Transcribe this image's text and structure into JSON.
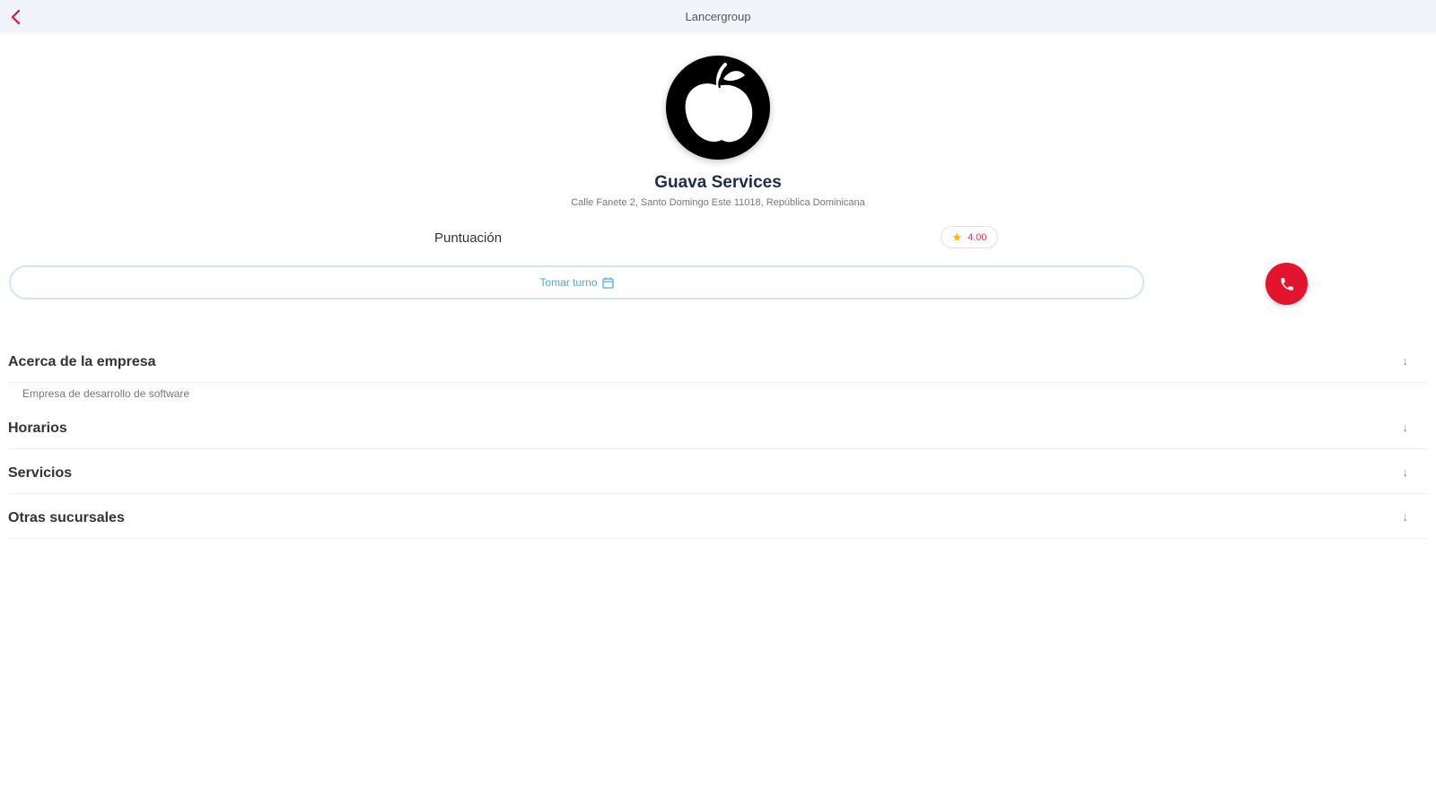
{
  "header": {
    "title": "Lancergroup",
    "back_icon": "chevron-left-icon",
    "accent_color": "#e3142e"
  },
  "company": {
    "name": "Guava Services",
    "address": "Calle Fanete 2, Santo Domingo Este 11018, República Dominicana",
    "logo_icon": "apple-logo-icon"
  },
  "rating": {
    "label": "Puntuación",
    "value": "4.00",
    "icon": "star-icon",
    "star_color": "#f5b400"
  },
  "actions": {
    "take_turn_label": "Tomar turno",
    "take_turn_icon": "calendar-icon",
    "call_icon": "phone-icon",
    "call_color": "#e3142e"
  },
  "sections": [
    {
      "title": "Acerca de la empresa",
      "description": "Empresa de desarrollo de software"
    },
    {
      "title": "Horarios"
    },
    {
      "title": "Servicios"
    },
    {
      "title": "Otras sucursales"
    }
  ],
  "section_arrow": "↓"
}
